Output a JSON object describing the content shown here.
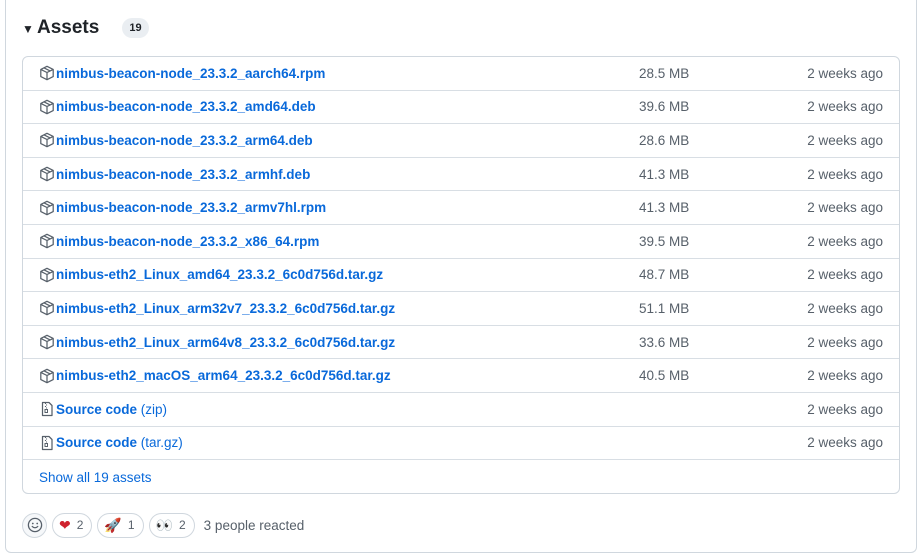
{
  "assets": {
    "title": "Assets",
    "count": "19",
    "items": [
      {
        "name": "nimbus-beacon-node_23.3.2_aarch64.rpm",
        "suffix": "",
        "size": "28.5 MB",
        "time": "2 weeks ago",
        "icon": "package-icon"
      },
      {
        "name": "nimbus-beacon-node_23.3.2_amd64.deb",
        "suffix": "",
        "size": "39.6 MB",
        "time": "2 weeks ago",
        "icon": "package-icon"
      },
      {
        "name": "nimbus-beacon-node_23.3.2_arm64.deb",
        "suffix": "",
        "size": "28.6 MB",
        "time": "2 weeks ago",
        "icon": "package-icon"
      },
      {
        "name": "nimbus-beacon-node_23.3.2_armhf.deb",
        "suffix": "",
        "size": "41.3 MB",
        "time": "2 weeks ago",
        "icon": "package-icon"
      },
      {
        "name": "nimbus-beacon-node_23.3.2_armv7hl.rpm",
        "suffix": "",
        "size": "41.3 MB",
        "time": "2 weeks ago",
        "icon": "package-icon"
      },
      {
        "name": "nimbus-beacon-node_23.3.2_x86_64.rpm",
        "suffix": "",
        "size": "39.5 MB",
        "time": "2 weeks ago",
        "icon": "package-icon"
      },
      {
        "name": "nimbus-eth2_Linux_amd64_23.3.2_6c0d756d.tar.gz",
        "suffix": "",
        "size": "48.7 MB",
        "time": "2 weeks ago",
        "icon": "package-icon"
      },
      {
        "name": "nimbus-eth2_Linux_arm32v7_23.3.2_6c0d756d.tar.gz",
        "suffix": "",
        "size": "51.1 MB",
        "time": "2 weeks ago",
        "icon": "package-icon"
      },
      {
        "name": "nimbus-eth2_Linux_arm64v8_23.3.2_6c0d756d.tar.gz",
        "suffix": "",
        "size": "33.6 MB",
        "time": "2 weeks ago",
        "icon": "package-icon"
      },
      {
        "name": "nimbus-eth2_macOS_arm64_23.3.2_6c0d756d.tar.gz",
        "suffix": "",
        "size": "40.5 MB",
        "time": "2 weeks ago",
        "icon": "package-icon"
      },
      {
        "name": "Source code",
        "suffix": " (zip)",
        "size": "",
        "time": "2 weeks ago",
        "icon": "file-zip-icon"
      },
      {
        "name": "Source code",
        "suffix": " (tar.gz)",
        "size": "",
        "time": "2 weeks ago",
        "icon": "file-zip-icon"
      }
    ],
    "show_all": "Show all 19 assets"
  },
  "reactions": {
    "items": [
      {
        "emoji": "❤",
        "count": "2",
        "name": "heart"
      },
      {
        "emoji": "🚀",
        "count": "1",
        "name": "rocket"
      },
      {
        "emoji": "👀",
        "count": "2",
        "name": "eyes"
      }
    ],
    "summary": "3 people reacted"
  },
  "colors": {
    "link": "#0969da",
    "muted": "#57606a",
    "border": "#d0d7de"
  }
}
